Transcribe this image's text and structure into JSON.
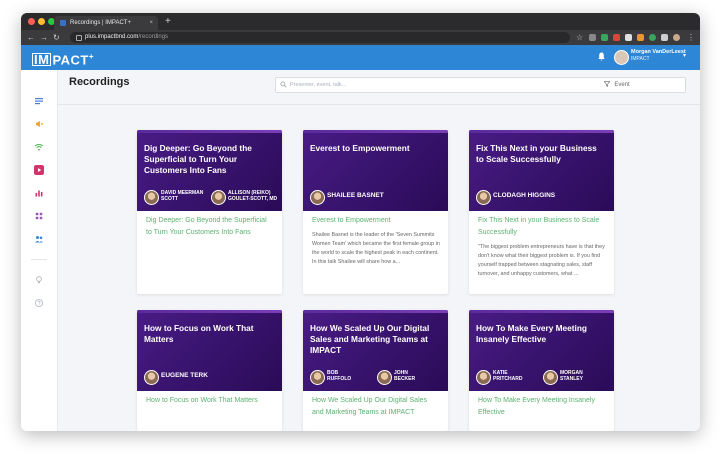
{
  "browser": {
    "tab_title": "Recordings | IMPACT+",
    "tab_close": "×",
    "new_tab": "+",
    "url_domain": "plus.impactbnd.com",
    "url_path": "/recordings",
    "colors": {
      "close": "#ff5f57",
      "min": "#febc2e",
      "max": "#28c840"
    }
  },
  "app": {
    "logo_boxed": "IM",
    "logo_rest": "PACT",
    "logo_plus": "+",
    "user_name": "Morgan VanDerLeest",
    "user_org": "IMPACT",
    "accent": "#2e86d6"
  },
  "sidebar": {
    "items": [
      {
        "icon": "list-icon",
        "color": "#4a7fd6"
      },
      {
        "icon": "megaphone-icon",
        "color": "#f0a830"
      },
      {
        "icon": "wifi-icon",
        "color": "#5cb85c"
      },
      {
        "icon": "play-icon",
        "color": "#d6336c"
      },
      {
        "icon": "bar-chart-icon",
        "color": "#d6336c"
      },
      {
        "icon": "puzzle-icon",
        "color": "#9b59b6"
      },
      {
        "icon": "users-icon",
        "color": "#3a86d6"
      },
      {
        "icon": "lightbulb-icon",
        "color": "#b8bcc6"
      },
      {
        "icon": "help-icon",
        "color": "#b8bcc6"
      }
    ]
  },
  "page": {
    "title": "Recordings",
    "search_placeholder": "Presenter, event, talk...",
    "filter_label": "Event"
  },
  "cards": [
    {
      "thumb_title": "Dig Deeper: Go Beyond the Superficial to Turn Your Customers Into Fans",
      "speakers": [
        {
          "name": "DAVID MEERMAN SCOTT"
        },
        {
          "name": "ALLISON (REIKO) GOULET-SCOTT, MD"
        }
      ],
      "title": "Dig Deeper: Go Beyond the Superficial to Turn Your Customers Into Fans",
      "description": ""
    },
    {
      "thumb_title": "Everest to Empowerment",
      "speakers": [
        {
          "name": "SHAILEE BASNET"
        }
      ],
      "title": "Everest to Empowerment",
      "description": "Shailee Basnet is the leader of the 'Seven Summits Women Team' which became the first female group in the world to scale the highest peak in each continent. In this talk Shailee will share how a..."
    },
    {
      "thumb_title": "Fix This Next in your Business to Scale Successfully",
      "speakers": [
        {
          "name": "CLODAGH HIGGINS"
        }
      ],
      "title": "Fix This Next in your Business to Scale Successfully",
      "description": "\"The biggest problem entrepreneurs have is that they don't know what their biggest problem is. If you find yourself trapped between stagnating sales, staff turnover, and unhappy customers, what ..."
    },
    {
      "thumb_title": "How to Focus on Work That Matters",
      "speakers": [
        {
          "name": "EUGENE TERK"
        }
      ],
      "title": "How to Focus on Work That Matters",
      "description": ""
    },
    {
      "thumb_title": "How We Scaled Up Our Digital Sales and Marketing Teams at IMPACT",
      "speakers": [
        {
          "name": "BOB RUFFOLO"
        },
        {
          "name": "JOHN BECKER"
        }
      ],
      "title": "How We Scaled Up Our Digital Sales and Marketing Teams at IMPACT",
      "description": ""
    },
    {
      "thumb_title": "How To Make Every Meeting Insanely Effective",
      "speakers": [
        {
          "name": "KATIE PRITCHARD"
        },
        {
          "name": "MORGAN STANLEY"
        }
      ],
      "title": "How To Make Every Meeting Insanely Effective",
      "description": ""
    }
  ]
}
